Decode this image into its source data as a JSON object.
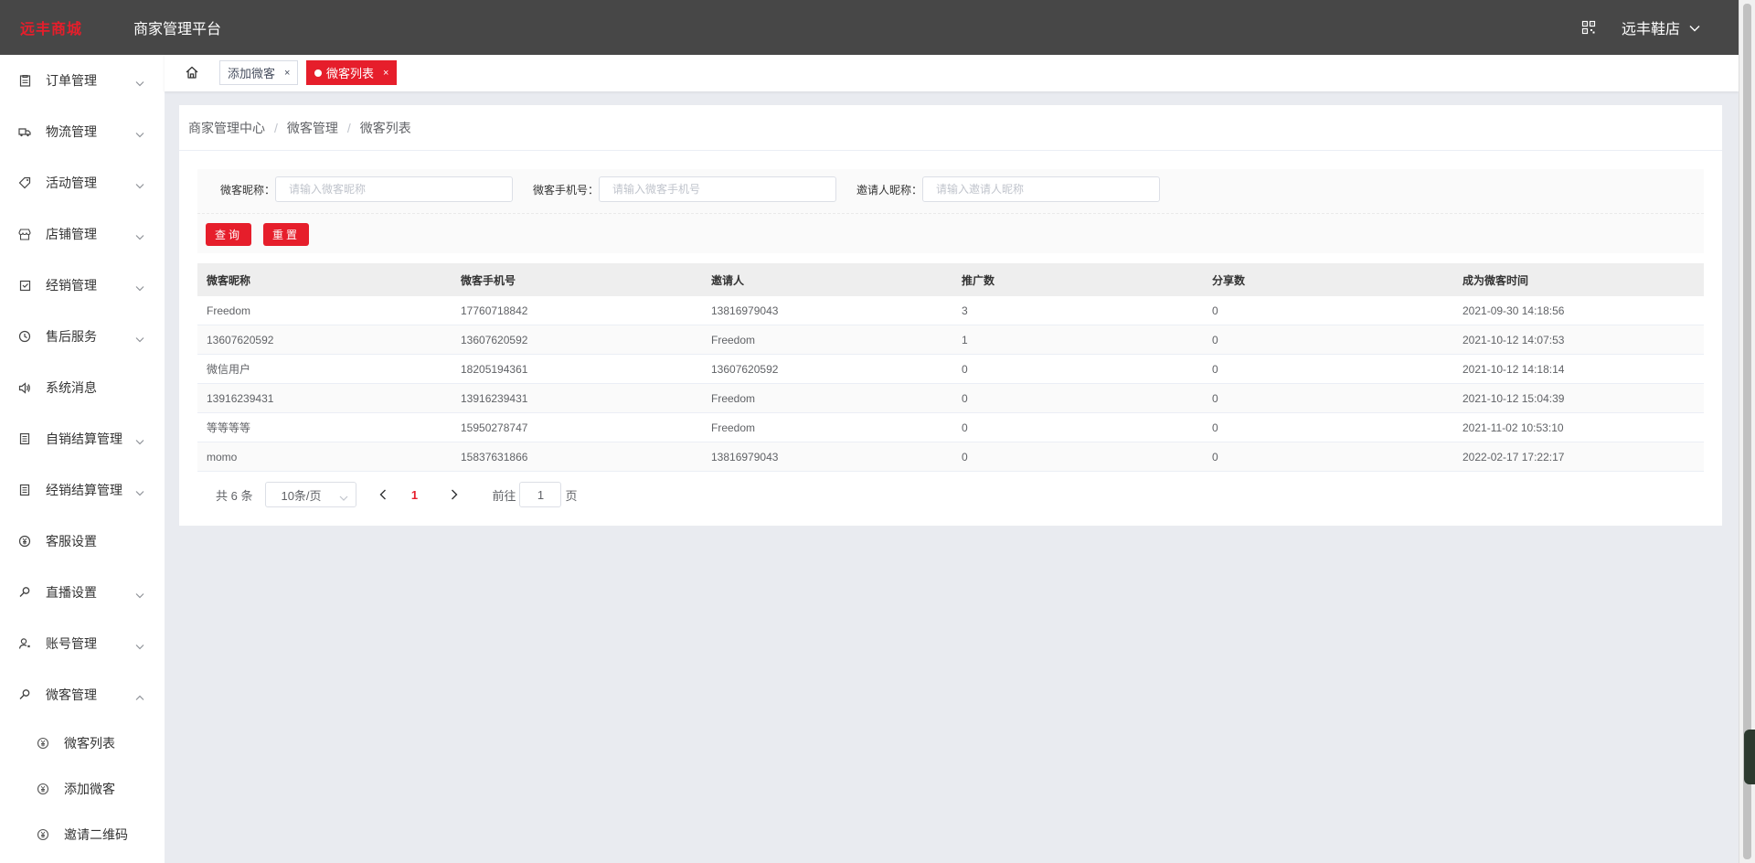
{
  "header": {
    "logo_text": "远丰商城",
    "platform_title": "商家管理平台",
    "store_name": "远丰鞋店"
  },
  "sidebar": {
    "items": [
      {
        "label": "订单管理",
        "icon": "clipboard-icon",
        "expandable": true
      },
      {
        "label": "物流管理",
        "icon": "truck-icon",
        "expandable": true
      },
      {
        "label": "活动管理",
        "icon": "tag-icon",
        "expandable": true
      },
      {
        "label": "店铺管理",
        "icon": "store-icon",
        "expandable": true
      },
      {
        "label": "经销管理",
        "icon": "box-icon",
        "expandable": true
      },
      {
        "label": "售后服务",
        "icon": "clock-icon",
        "expandable": true
      },
      {
        "label": "系统消息",
        "icon": "speaker-icon",
        "expandable": false
      },
      {
        "label": "自销结算管理",
        "icon": "ledger-icon",
        "expandable": true
      },
      {
        "label": "经销结算管理",
        "icon": "ledger-icon",
        "expandable": true
      },
      {
        "label": "客服设置",
        "icon": "currency-icon",
        "expandable": false
      },
      {
        "label": "直播设置",
        "icon": "key-icon",
        "expandable": true
      },
      {
        "label": "账号管理",
        "icon": "user-icon",
        "expandable": true
      },
      {
        "label": "微客管理",
        "icon": "key-icon",
        "expandable": true,
        "expanded": true
      }
    ],
    "sub_items": [
      {
        "label": "微客列表"
      },
      {
        "label": "添加微客"
      },
      {
        "label": "邀请二维码"
      }
    ]
  },
  "tabs": {
    "items": [
      {
        "label": "添加微客",
        "close": "×"
      },
      {
        "label": "微客列表",
        "close": "×"
      }
    ]
  },
  "breadcrumb": {
    "items": [
      "商家管理中心",
      "微客管理",
      "微客列表"
    ],
    "separator": "/"
  },
  "search": {
    "nickname_label": "微客昵称：",
    "nickname_placeholder": "请输入微客昵称",
    "phone_label": "微客手机号：",
    "phone_placeholder": "请输入微客手机号",
    "inviter_label": "邀请人昵称：",
    "inviter_placeholder": "请输入邀请人昵称",
    "query_button": "查询",
    "reset_button": "重置"
  },
  "table": {
    "headers": [
      "微客昵称",
      "微客手机号",
      "邀请人",
      "推广数",
      "分享数",
      "成为微客时间"
    ],
    "rows": [
      [
        "Freedom",
        "17760718842",
        "13816979043",
        "3",
        "0",
        "2021-09-30 14:18:56"
      ],
      [
        "13607620592",
        "13607620592",
        "Freedom",
        "1",
        "0",
        "2021-10-12 14:07:53"
      ],
      [
        "微信用户",
        "18205194361",
        "13607620592",
        "0",
        "0",
        "2021-10-12 14:18:14"
      ],
      [
        "13916239431",
        "13916239431",
        "Freedom",
        "0",
        "0",
        "2021-10-12 15:04:39"
      ],
      [
        "等等等等",
        "15950278747",
        "Freedom",
        "0",
        "0",
        "2021-11-02 10:53:10"
      ],
      [
        "momo",
        "15837631866",
        "13816979043",
        "0",
        "0",
        "2022-02-17 17:22:17"
      ]
    ]
  },
  "pagination": {
    "total": "共 6 条",
    "page_size": "10条/页",
    "current_page": "1",
    "goto_prefix": "前往",
    "goto_value": "1",
    "goto_suffix": "页"
  },
  "colors": {
    "header_bg": "#474747",
    "accent": "#e61e2b",
    "page_bg": "#e9ebf0"
  }
}
